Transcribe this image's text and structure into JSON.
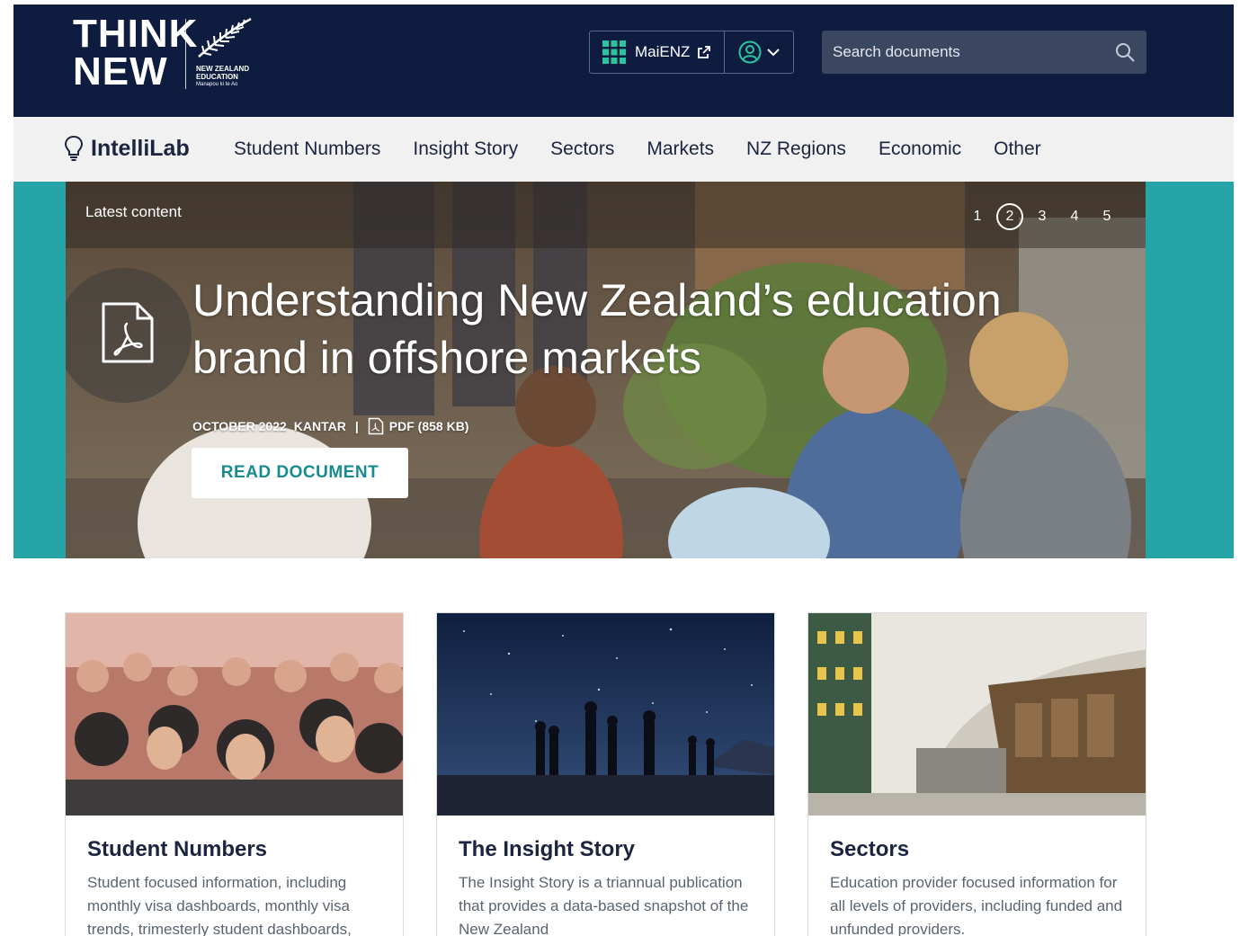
{
  "header": {
    "logo_line1": "THINK",
    "logo_line2": "NEW",
    "logo_org": "NEW ZEALAND\nEDUCATION",
    "logo_tagline": "Manapou ki te Ao",
    "maienz_label": "MaiENZ",
    "search_placeholder": "Search documents",
    "colors": {
      "background": "#0d1c3f",
      "accent": "#2cc4a0"
    }
  },
  "nav": {
    "brand": "IntelliLab",
    "items": [
      "Student Numbers",
      "Insight Story",
      "Sectors",
      "Markets",
      "NZ Regions",
      "Economic",
      "Other"
    ]
  },
  "hero": {
    "label": "Latest content",
    "pages": [
      "1",
      "2",
      "3",
      "4",
      "5"
    ],
    "active_page": "2",
    "title_line1": "Understanding New Zealand’s education",
    "title_line2": "brand in offshore markets",
    "meta_date": "OCTOBER 2022",
    "meta_source": "KANTAR",
    "meta_separator": "|",
    "meta_file": "PDF (858 KB)",
    "button_label": "READ DOCUMENT",
    "colors": {
      "band": "#26a4a6",
      "button_text": "#178c90"
    }
  },
  "cards": [
    {
      "title": "Student Numbers",
      "description": "Student focused information, including monthly visa dashboards, monthly visa trends, trimesterly student dashboards,"
    },
    {
      "title": "The Insight Story",
      "description": "The Insight Story is a triannual publication that provides a data-based snapshot of the New Zealand"
    },
    {
      "title": "Sectors",
      "description": "Education provider focused information for all levels of providers, including funded and unfunded providers."
    }
  ]
}
